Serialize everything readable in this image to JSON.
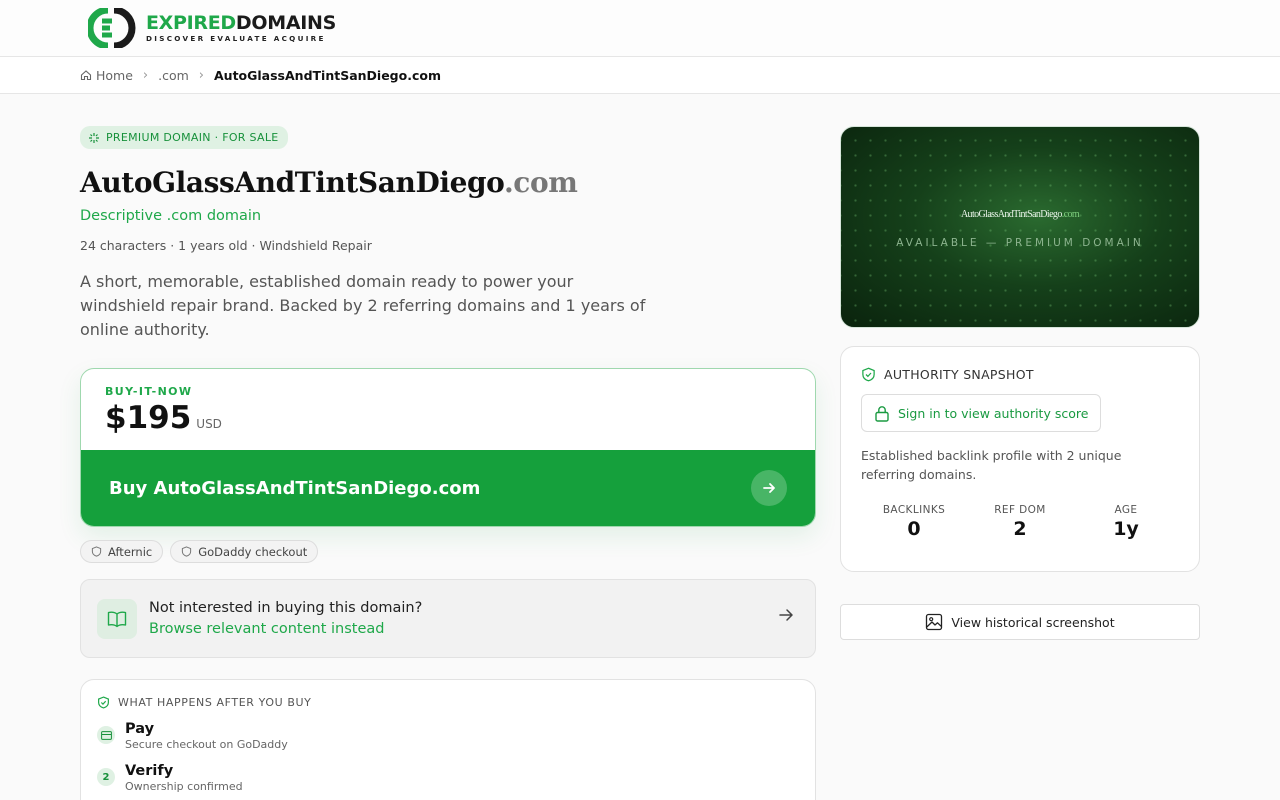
{
  "header": {
    "logo_word1": "EXPIRED",
    "logo_word2": "DOMAINS",
    "logo_tagline": "DISCOVER EVALUATE ACQUIRE"
  },
  "breadcrumb": {
    "home": "Home",
    "tld": ".com",
    "current": "AutoGlassAndTintSanDiego.com"
  },
  "listing": {
    "badge": "PREMIUM DOMAIN · FOR SALE",
    "name": "AutoGlassAndTintSanDiego",
    "tld": ".com",
    "subtitle": "Descriptive .com domain",
    "meta": "24 characters · 1 years old · Windshield Repair",
    "description": "A short, memorable, established domain ready to power your windshield repair brand. Backed by 2 referring domains and 1 years of online authority."
  },
  "buy": {
    "label": "BUY-IT-NOW",
    "price": "$195",
    "currency": "USD",
    "button_label": "Buy AutoGlassAndTintSanDiego.com"
  },
  "chips": [
    "Afternic",
    "GoDaddy checkout"
  ],
  "browse": {
    "question": "Not interested in buying this domain?",
    "link": "Browse relevant content instead"
  },
  "after_buy": {
    "heading": "WHAT HAPPENS AFTER YOU BUY",
    "steps": [
      {
        "marker": "",
        "title": "Pay",
        "sub": "Secure checkout on GoDaddy"
      },
      {
        "marker": "2",
        "title": "Verify",
        "sub": "Ownership confirmed"
      }
    ]
  },
  "hero": {
    "domain_name": "AutoGlassAndTintSanDiego",
    "domain_tld": ".com",
    "subtitle": "AVAILABLE — PREMIUM DOMAIN"
  },
  "authority": {
    "heading": "AUTHORITY SNAPSHOT",
    "signin_label": "Sign in to view authority score",
    "description": "Established backlink profile with 2 unique referring domains.",
    "stats": [
      {
        "label": "BACKLINKS",
        "value": "0"
      },
      {
        "label": "REF DOM",
        "value": "2"
      },
      {
        "label": "AGE",
        "value": "1y"
      }
    ]
  },
  "history_button": "View historical screenshot",
  "colors": {
    "accent": "#15a03c",
    "accent_text": "#1fa84a",
    "badge_bg": "#dff1e3",
    "hero_dark": "#0a230d"
  },
  "icons": [
    "logo-mark",
    "home-icon",
    "chevron-right-icon",
    "sparkle-icon",
    "arrow-right-icon",
    "shield-icon",
    "book-icon",
    "card-icon",
    "lock-icon",
    "image-icon"
  ]
}
